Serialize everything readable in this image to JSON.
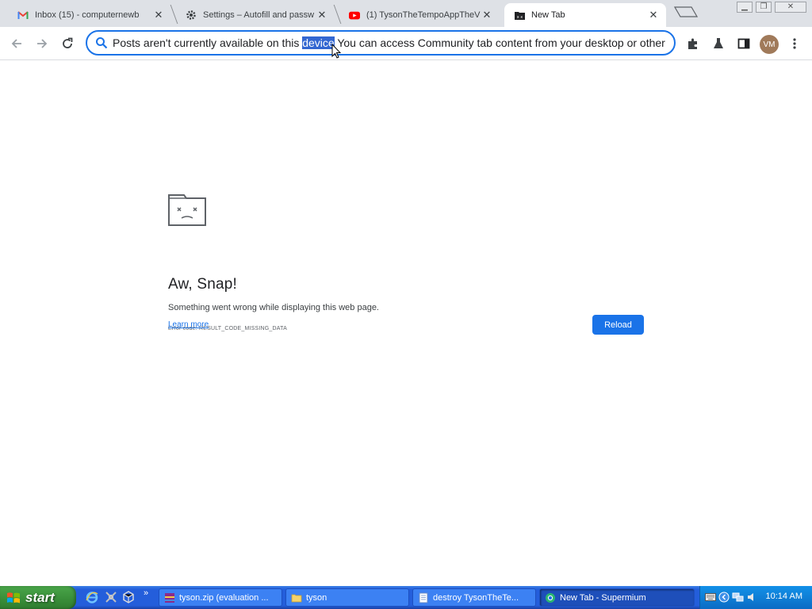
{
  "browser": {
    "tabs": [
      {
        "title": "Inbox (15) - computernewb",
        "favicon": "gmail-icon",
        "active": false
      },
      {
        "title": "Settings – Autofill and passw",
        "favicon": "gear-icon",
        "active": false
      },
      {
        "title": "(1) TysonTheTempoAppTheV",
        "favicon": "youtube-icon",
        "active": false
      },
      {
        "title": "New Tab",
        "favicon": "crashed-tab-icon",
        "active": true
      }
    ],
    "omnibox_text": "Posts aren't currently available on this device You can access Community tab content from your desktop or other",
    "omnibox_selected_word": "device",
    "profile_initials": "VM",
    "accent": "#1a73e8"
  },
  "error_page": {
    "title": "Aw, Snap!",
    "message": "Something went wrong while displaying this web page.",
    "error_code": "Error code: RESULT_CODE_MISSING_DATA",
    "learn_more": "Learn more",
    "reload_label": "Reload"
  },
  "taskbar": {
    "start_label": "start",
    "items": [
      {
        "label": "tyson.zip (evaluation ...",
        "icon": "winrar-icon",
        "active": false
      },
      {
        "label": "tyson",
        "icon": "folder-icon",
        "active": false
      },
      {
        "label": "destroy TysonTheTe...",
        "icon": "notepad-icon",
        "active": false
      },
      {
        "label": "New Tab - Supermium",
        "icon": "supermium-icon",
        "active": true
      }
    ],
    "clock": "10:14 AM"
  }
}
